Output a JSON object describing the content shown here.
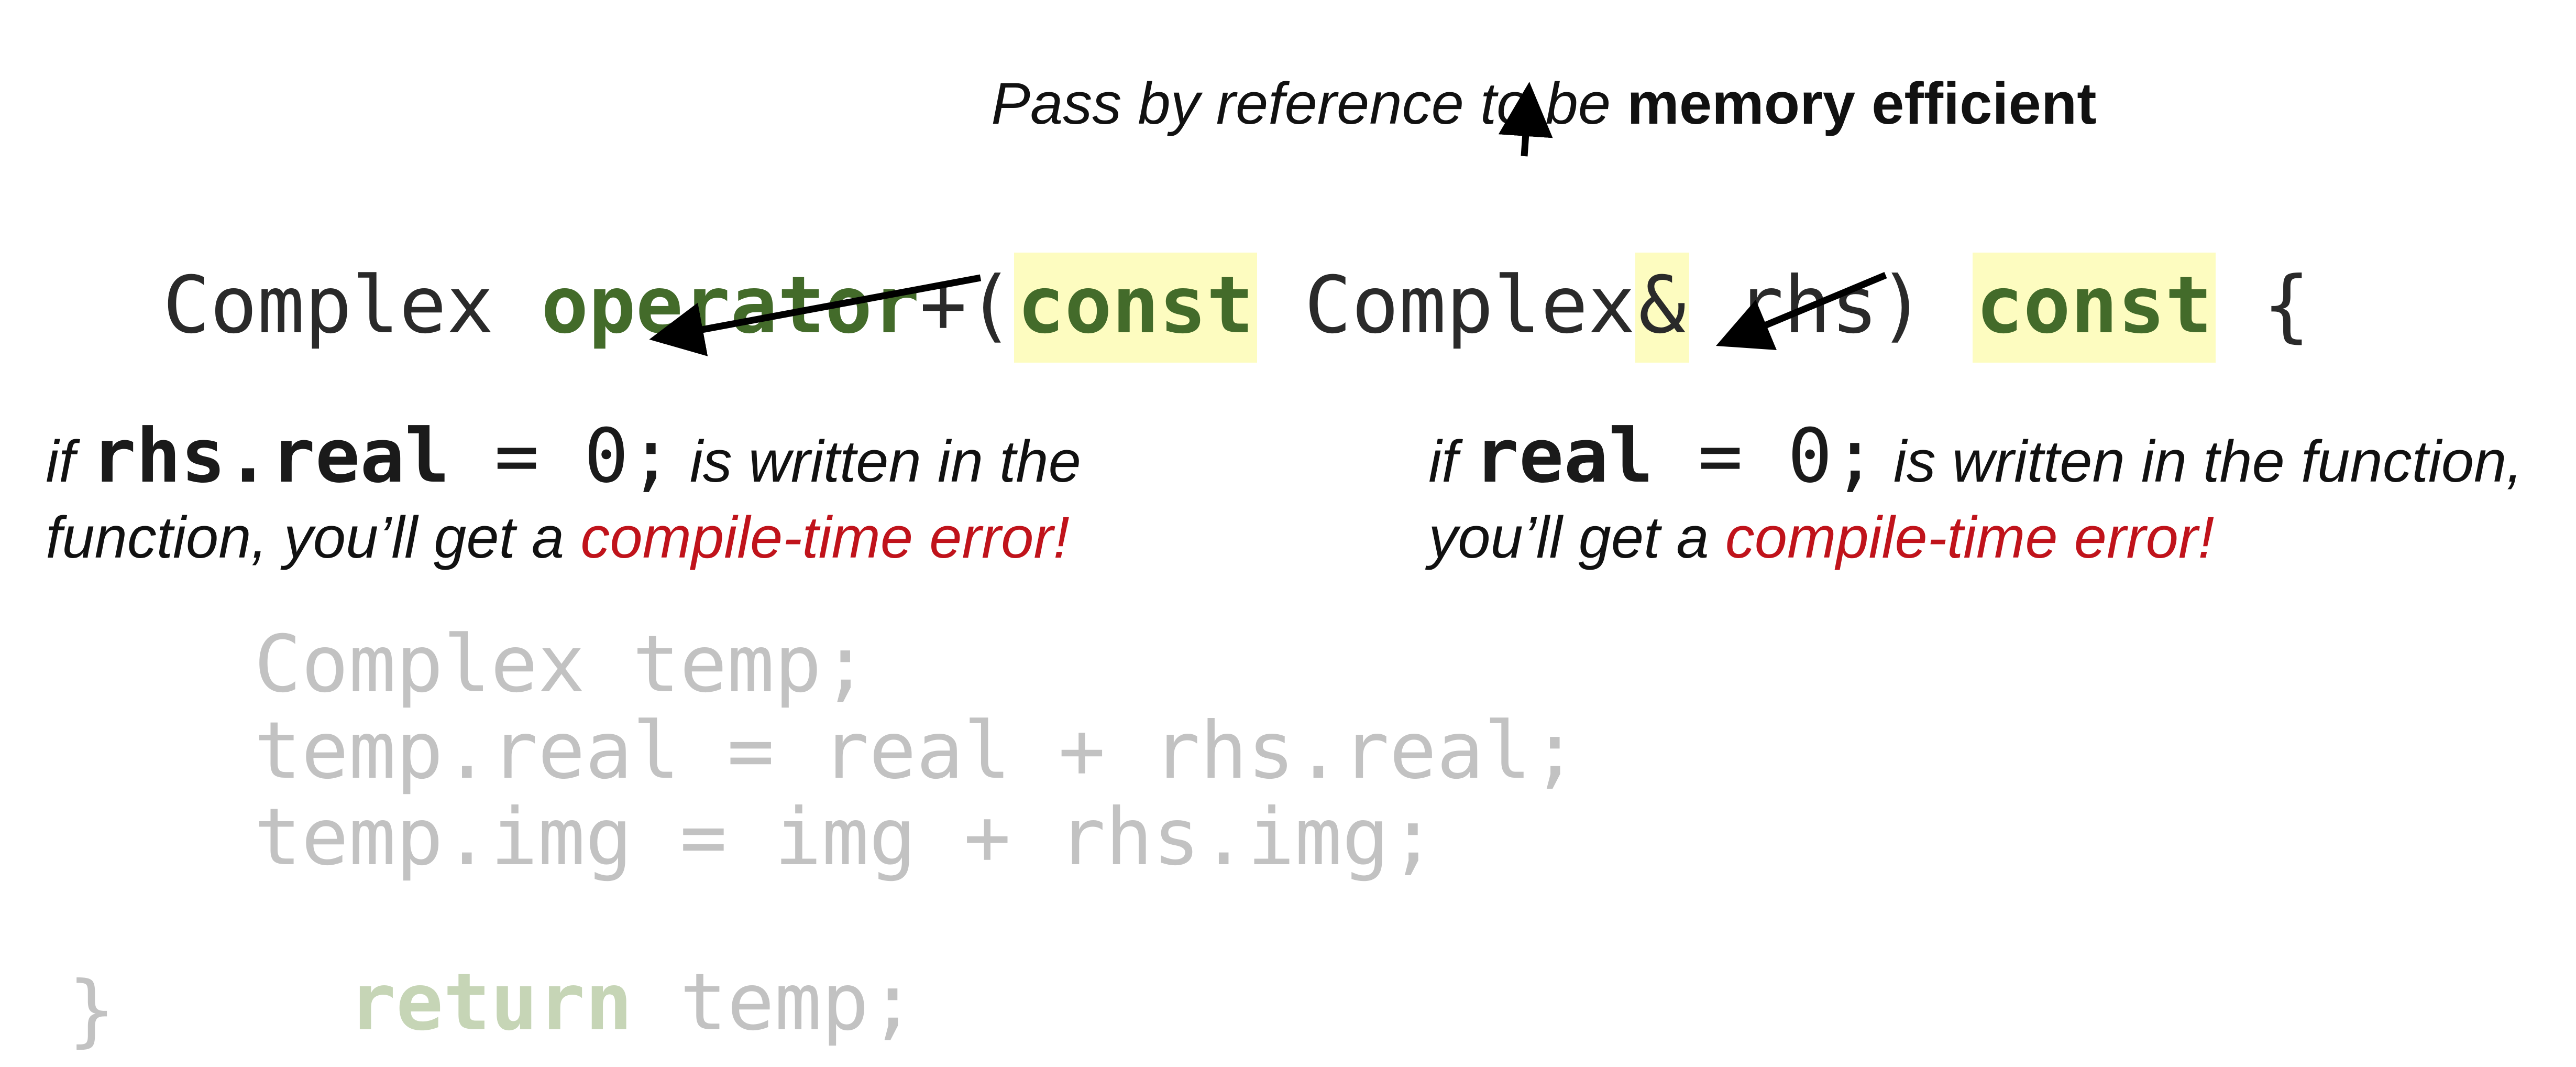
{
  "annotations": {
    "top": {
      "prefix": "Pass by reference to be ",
      "bold": "memory efficient"
    },
    "left": {
      "if_word": "if",
      "code_bold": "rhs.real",
      "code_rest": " = 0;",
      "rest_line1": " is written in the",
      "line2_prefix": "function, you’ll get a ",
      "error_text": "compile-time error!"
    },
    "right": {
      "if_word": "if",
      "code_bold": "real",
      "code_rest": " = 0;",
      "rest_line1": " is written in the function,",
      "line2_prefix": "you’ll get a ",
      "error_text": "compile-time error!"
    }
  },
  "code": {
    "signature": {
      "return_type": "Complex ",
      "operator_kw": "operator",
      "operator_sym": "+(",
      "const_kw": "const",
      "param_type": " Complex",
      "amp": "&",
      "param_rest": " rhs) ",
      "const_kw2": "const",
      "brace_open": " {"
    },
    "body": [
      "Complex temp;",
      "temp.real = real + rhs.real;",
      "temp.img = img + rhs.img;"
    ],
    "return_kw": "return",
    "return_rest": " temp;",
    "brace_close": "}"
  },
  "colors": {
    "keyword": "#436b2a",
    "highlight": "#fdfcc0",
    "error": "#c0131b",
    "faded": "#c2c2c2",
    "faded_keyword": "#c6d5b6"
  }
}
